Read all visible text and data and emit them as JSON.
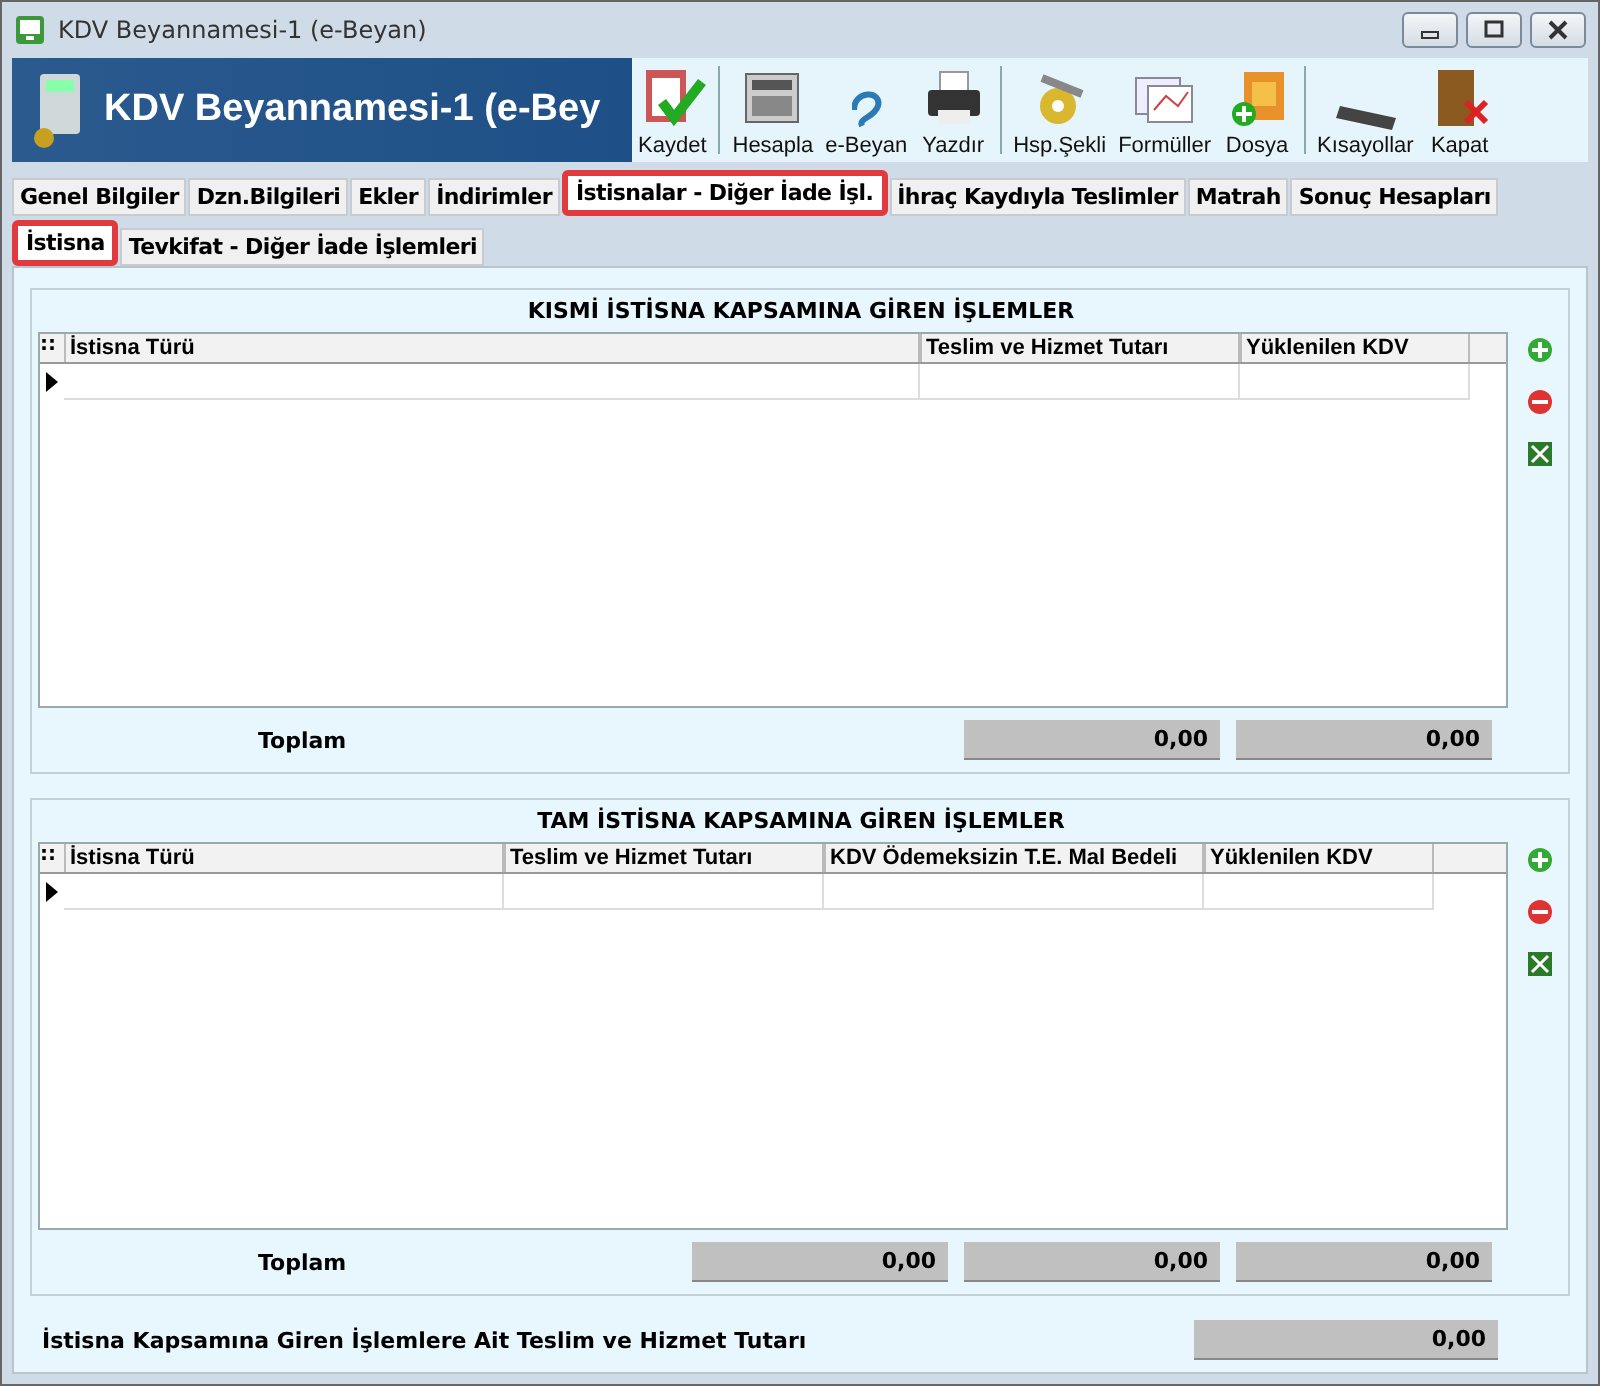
{
  "window": {
    "title": "KDV Beyannamesi-1 (e-Beyan)"
  },
  "header": {
    "title": "KDV Beyannamesi-1 (e-Bey"
  },
  "toolbar": [
    {
      "label": "Kaydet",
      "kind": "save"
    },
    {
      "label": "Hesapla",
      "kind": "calculate"
    },
    {
      "label": "e-Beyan",
      "kind": "ebeyan"
    },
    {
      "label": "Yazdır",
      "kind": "print"
    },
    {
      "label": "Hsp.Şekli",
      "kind": "settings"
    },
    {
      "label": "Formüller",
      "kind": "formulas"
    },
    {
      "label": "Dosya",
      "kind": "file"
    },
    {
      "label": "Kısayollar",
      "kind": "shortcuts"
    },
    {
      "label": "Kapat",
      "kind": "close"
    }
  ],
  "tabs": [
    {
      "label": "Genel Bilgiler",
      "selected": false
    },
    {
      "label": "Dzn.Bilgileri",
      "selected": false
    },
    {
      "label": "Ekler",
      "selected": false
    },
    {
      "label": "İndirimler",
      "selected": false
    },
    {
      "label": "İstisnalar - Diğer İade İşl.",
      "selected": true
    },
    {
      "label": "İhraç Kaydıyla Teslimler",
      "selected": false
    },
    {
      "label": "Matrah",
      "selected": false
    },
    {
      "label": "Sonuç Hesapları",
      "selected": false
    }
  ],
  "subtabs": [
    {
      "label": "İstisna",
      "selected": true
    },
    {
      "label": "Tevkifat - Diğer İade İşlemleri",
      "selected": false
    }
  ],
  "sections": [
    {
      "title": "KISMİ İSTİSNA KAPSAMINA GİREN İŞLEMLER",
      "handle": "::",
      "columns": [
        "İstisna Türü",
        "Teslim ve Hizmet Tutarı",
        "Yüklenilen KDV"
      ],
      "total_label": "Toplam",
      "totals": [
        "0,00",
        "0,00"
      ]
    },
    {
      "title": "TAM İSTİSNA KAPSAMINA GİREN İŞLEMLER",
      "handle": "::",
      "columns": [
        "İstisna Türü",
        "Teslim ve Hizmet Tutarı",
        "KDV Ödemeksizin T.E. Mal Bedeli",
        "Yüklenilen KDV"
      ],
      "total_label": "Toplam",
      "totals": [
        "0,00",
        "0,00",
        "0,00"
      ]
    }
  ],
  "footer": {
    "label": "İstisna Kapsamına Giren İşlemlere Ait Teslim ve Hizmet Tutarı",
    "value": "0,00"
  }
}
